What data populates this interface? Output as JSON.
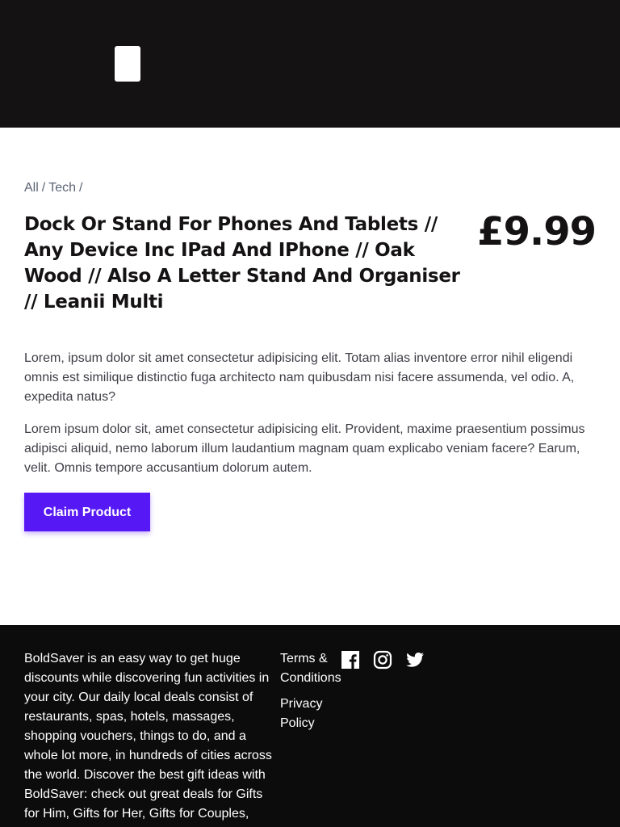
{
  "header": {
    "menu_icon": "menu-icon"
  },
  "breadcrumb": {
    "items": [
      "All",
      "Tech"
    ],
    "separator": "/"
  },
  "product": {
    "title": "Dock Or Stand For Phones And Tablets // Any Device Inc IPad And IPhone // Oak Wood // Also A Letter Stand And Organiser // Leanii Multi",
    "price": "£9.99",
    "description_1": "Lorem, ipsum dolor sit amet consectetur adipisicing elit. Totam alias inventore error nihil eligendi omnis est similique distinctio fuga architecto nam quibusdam nisi facere assumenda, vel odio. A, expedita natus?",
    "description_2": "Lorem ipsum dolor sit, amet consectetur adipisicing elit. Provident, maxime praesentium possimus adipisci aliquid, nemo laborum illum laudantium magnam quam explicabo veniam facere? Earum, velit. Omnis tempore accusantium dolorum autem.",
    "claim_label": "Claim Product"
  },
  "footer": {
    "about": "BoldSaver is an easy way to get huge discounts while discovering fun activities in your city. Our daily local deals consist of restaurants, spas, hotels, massages, shopping vouchers, things to do, and a whole lot more, in hundreds of cities across the world. Discover the best gift ideas with BoldSaver: check out great deals for Gifts for Him, Gifts for Her, Gifts for Couples,",
    "links": [
      "Terms & Conditions",
      "Privacy Policy"
    ],
    "social_icons": [
      "facebook-icon",
      "instagram-icon",
      "twitter-icon"
    ]
  },
  "colors": {
    "header_bg": "#141213",
    "footer_bg": "#0c0c0c",
    "accent": "#5618f5",
    "text_dark": "#141213",
    "breadcrumb": "#5b6475"
  }
}
